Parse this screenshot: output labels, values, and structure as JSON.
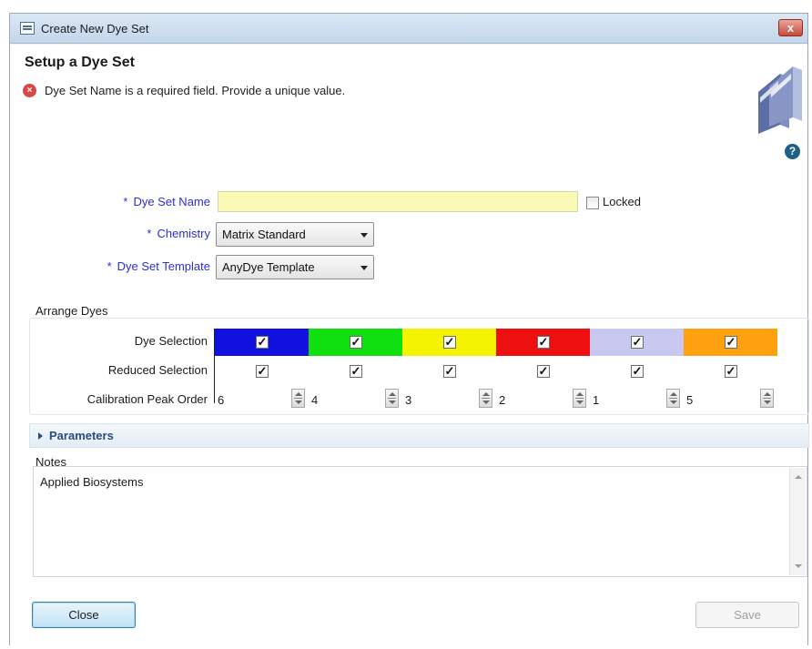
{
  "window": {
    "title": "Create New Dye Set",
    "close_glyph": "x"
  },
  "header": {
    "title": "Setup a Dye Set",
    "error_message": "Dye Set Name is a required field. Provide a unique value.",
    "help_glyph": "?"
  },
  "form": {
    "required_marker": "*",
    "dye_set_name_label": "Dye Set Name",
    "dye_set_name_value": "",
    "locked_label": "Locked",
    "locked_checked": false,
    "chemistry_label": "Chemistry",
    "chemistry_value": "Matrix Standard",
    "template_label": "Dye Set Template",
    "template_value": "AnyDye Template",
    "input_fill_color": "#fafab6"
  },
  "arrange": {
    "title": "Arrange Dyes",
    "dye_selection_label": "Dye Selection",
    "reduced_selection_label": "Reduced Selection",
    "calibration_label": "Calibration Peak Order",
    "check_glyph": "✓",
    "dye_colors": [
      "#1010e0",
      "#10e010",
      "#f4f400",
      "#ee1010",
      "#c8c8f0",
      "#ffa010"
    ],
    "dye_selected": [
      true,
      true,
      true,
      true,
      true,
      true
    ],
    "reduced_selected": [
      true,
      true,
      true,
      true,
      true,
      true
    ],
    "peak_order": [
      "6",
      "4",
      "3",
      "2",
      "1",
      "5"
    ]
  },
  "parameters": {
    "label": "Parameters"
  },
  "notes": {
    "label": "Notes",
    "value": "Applied Biosystems"
  },
  "buttons": {
    "close": "Close",
    "save": "Save"
  }
}
